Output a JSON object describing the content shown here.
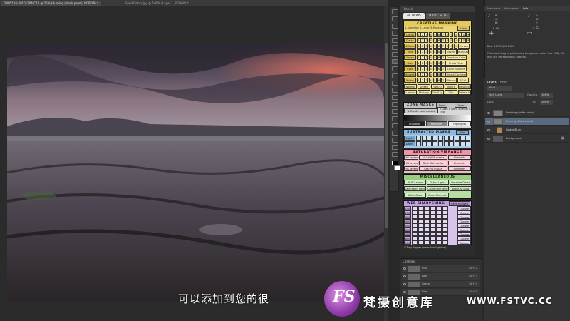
{
  "doc_tabs": [
    "14B5126-20101204.CR2 @ 25% (Burning (black paint), RGB/16) *",
    "Solid Colors.jpg @ 100% (Layer 1, RGB/8*) *"
  ],
  "actions_panel": {
    "header": "Panels",
    "tabs": [
      "ACTIONS",
      "BASIC + TF"
    ],
    "creative_masking": {
      "title": "CREATIVE MASKING",
      "subtitle": "1-Selection 2-Layer 3-Masking",
      "view": "View",
      "rows": [
        [
          "Lights",
          "1",
          "2",
          "3",
          "4",
          "5",
          "6",
          "7",
          "8",
          "9",
          "10",
          "L",
          "D",
          "M"
        ],
        [
          "Darks",
          "1",
          "2",
          "3",
          "4",
          "5",
          "6",
          "7",
          "8",
          "9",
          "10",
          "L",
          "D",
          "M"
        ],
        [
          "Midtones",
          "1",
          "2",
          "3",
          "4",
          "5",
          "6",
          "7",
          "8",
          "9",
          "10",
          "Curves"
        ],
        [
          "Red",
          "1",
          "2",
          "3",
          "4",
          "5",
          "6",
          "7",
          "Levels",
          "Hue/Sat"
        ],
        [
          "Green",
          "1",
          "2",
          "3",
          "4",
          "5",
          "6",
          "7",
          "Selective Color"
        ],
        [
          "Blue",
          "1",
          "2",
          "3",
          "4",
          "5",
          "6",
          "7",
          "Photo Filter"
        ],
        [
          "Cyan",
          "1",
          "2",
          "3",
          "4",
          "5",
          "6",
          "7",
          "Color Balance"
        ],
        [
          "Magenta",
          "1",
          "2",
          "3",
          "4",
          "5",
          "6",
          "7",
          "Bright/Contrast"
        ],
        [
          "Yellow",
          "1",
          "2",
          "3",
          "4",
          "5",
          "6",
          "7",
          "Vibrance",
          "B&W"
        ]
      ],
      "bottom": [
        "Normal",
        "Screen",
        "Soft/O",
        "Invert",
        "Deselect",
        "Luminos",
        "Multiply",
        "Ovr/Lay",
        "Clip",
        "Delete layer"
      ]
    },
    "zone_masks": {
      "title": "ZONE MASKS",
      "save": "Save",
      "view": "View",
      "create": "1-Create zone masks",
      "hint": "2-Load & paint 3-Select & clear",
      "labels": [
        "Shadows",
        "Midtones",
        "Highlights"
      ]
    },
    "subtracted_masks": {
      "title": "SUBTRACTED MASKS",
      "view": "View",
      "rows": [
        "Lights",
        "Darks"
      ]
    },
    "saturation_vibrance": {
      "title": "SATURATION/VIBRANCE",
      "rows": [
        "HIS layers",
        "HIS layers",
        "HIS layers"
      ],
      "actions": [
        "All Sat/Vib masks",
        "Both Sat masks",
        "Sat/Vib masks"
      ],
      "channels": [
        "Channels",
        "Channels",
        "Channels"
      ]
    },
    "miscellaneous": {
      "title": "MISCELLANEOUS",
      "buttons": [
        "B&W Layers",
        "Orton Lights",
        "Detailed Darks",
        "Saturation Painting",
        "Cloud Sharpening",
        "Blake & Glow",
        "Color Glow",
        "Clear Channels"
      ]
    },
    "web_sharpening": {
      "title": "WEB SHARPENING",
      "save": "Save for Web",
      "rows": [
        "100",
        "200",
        "300",
        "400",
        "500",
        "600",
        "700",
        "800",
        "900"
      ],
      "right": [
        "Choose",
        "Choose",
        "Choose",
        "Choose",
        "Choose",
        "Choose",
        "Choose",
        "Choose",
        "Choose"
      ]
    },
    "footer": "©Tony Kuyper (www.GoodLight.us)"
  },
  "channels_panel": {
    "title": "Channels",
    "rows": [
      {
        "name": "RGB",
        "shortcut": "Ctrl+2"
      },
      {
        "name": "Red",
        "shortcut": "Ctrl+3"
      },
      {
        "name": "Green",
        "shortcut": "Ctrl+4"
      },
      {
        "name": "Blue",
        "shortcut": "Ctrl+5"
      }
    ]
  },
  "info_panel": {
    "tabs": [
      "Navigator",
      "Histogram",
      "Info"
    ],
    "readout_a": "R:\nG:\nB:",
    "readout_b": "C:\nM:\nY:\nK:",
    "bits_a": "8-bit",
    "bits_b": "8-bit",
    "doc_line": "Doc: 101.3M/101.0M",
    "hint": "Click and drag to paint using foreground color. Use Shift, Alt, and Ctrl for additional options."
  },
  "layers_panel": {
    "tabs": [
      "Layers",
      "Paths"
    ],
    "filter": "Kind",
    "blend_mode": "Soft Light",
    "opacity_label": "Opacity:",
    "opacity": "100%",
    "fill_label": "Fill:",
    "fill": "100%",
    "lock_label": "Lock:",
    "layers": [
      {
        "name": "Dodging (white paint)",
        "selected": false
      },
      {
        "name": "Burning (black paint)",
        "selected": true
      },
      {
        "name": "Dodge/Burn",
        "selected": false
      },
      {
        "name": "Background",
        "selected": false
      }
    ]
  },
  "subtitle": "可以添加到您的很",
  "watermark": {
    "logo": "FS",
    "name": "梵摄创意库",
    "url": "WWW.FSTVC.CC"
  }
}
